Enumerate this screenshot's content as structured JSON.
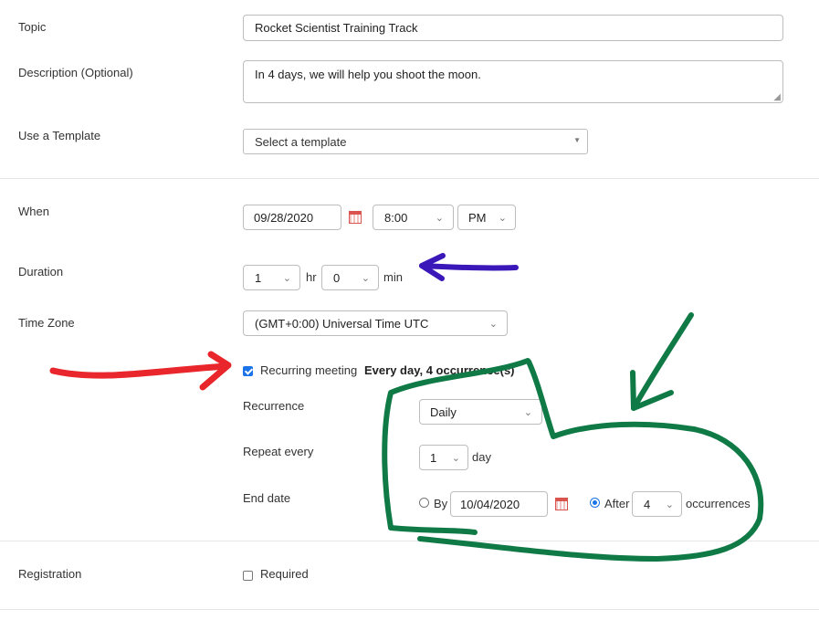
{
  "form": {
    "topic": {
      "label": "Topic",
      "value": "Rocket Scientist Training Track"
    },
    "description": {
      "label": "Description (Optional)",
      "value": "In 4 days, we will help you shoot the moon."
    },
    "template": {
      "label": "Use a Template",
      "placeholder": "Select a template"
    },
    "when": {
      "label": "When",
      "date": "09/28/2020",
      "time": "8:00",
      "ampm": "PM"
    },
    "duration": {
      "label": "Duration",
      "hours": "1",
      "hr_unit": "hr",
      "minutes": "0",
      "min_unit": "min"
    },
    "timezone": {
      "label": "Time Zone",
      "value": "(GMT+0:00) Universal Time UTC"
    },
    "recurring": {
      "label": "Recurring meeting",
      "summary": "Every day, 4 occurrence(s)",
      "checked": true
    },
    "recurrence": {
      "label": "Recurrence",
      "value": "Daily"
    },
    "repeat_every": {
      "label": "Repeat every",
      "value": "1",
      "unit": "day"
    },
    "end_date": {
      "label": "End date",
      "by_label": "By",
      "by_date": "10/04/2020",
      "after_label": "After",
      "after_count": "4",
      "after_unit": "occurrences",
      "selected": "after"
    },
    "registration": {
      "label": "Registration",
      "required_label": "Required",
      "checked": false
    }
  },
  "annotations": {
    "arrow_blue_color": "#3a17b8",
    "arrow_red_color": "#e8262b",
    "highlight_green_color": "#0f7a45"
  }
}
